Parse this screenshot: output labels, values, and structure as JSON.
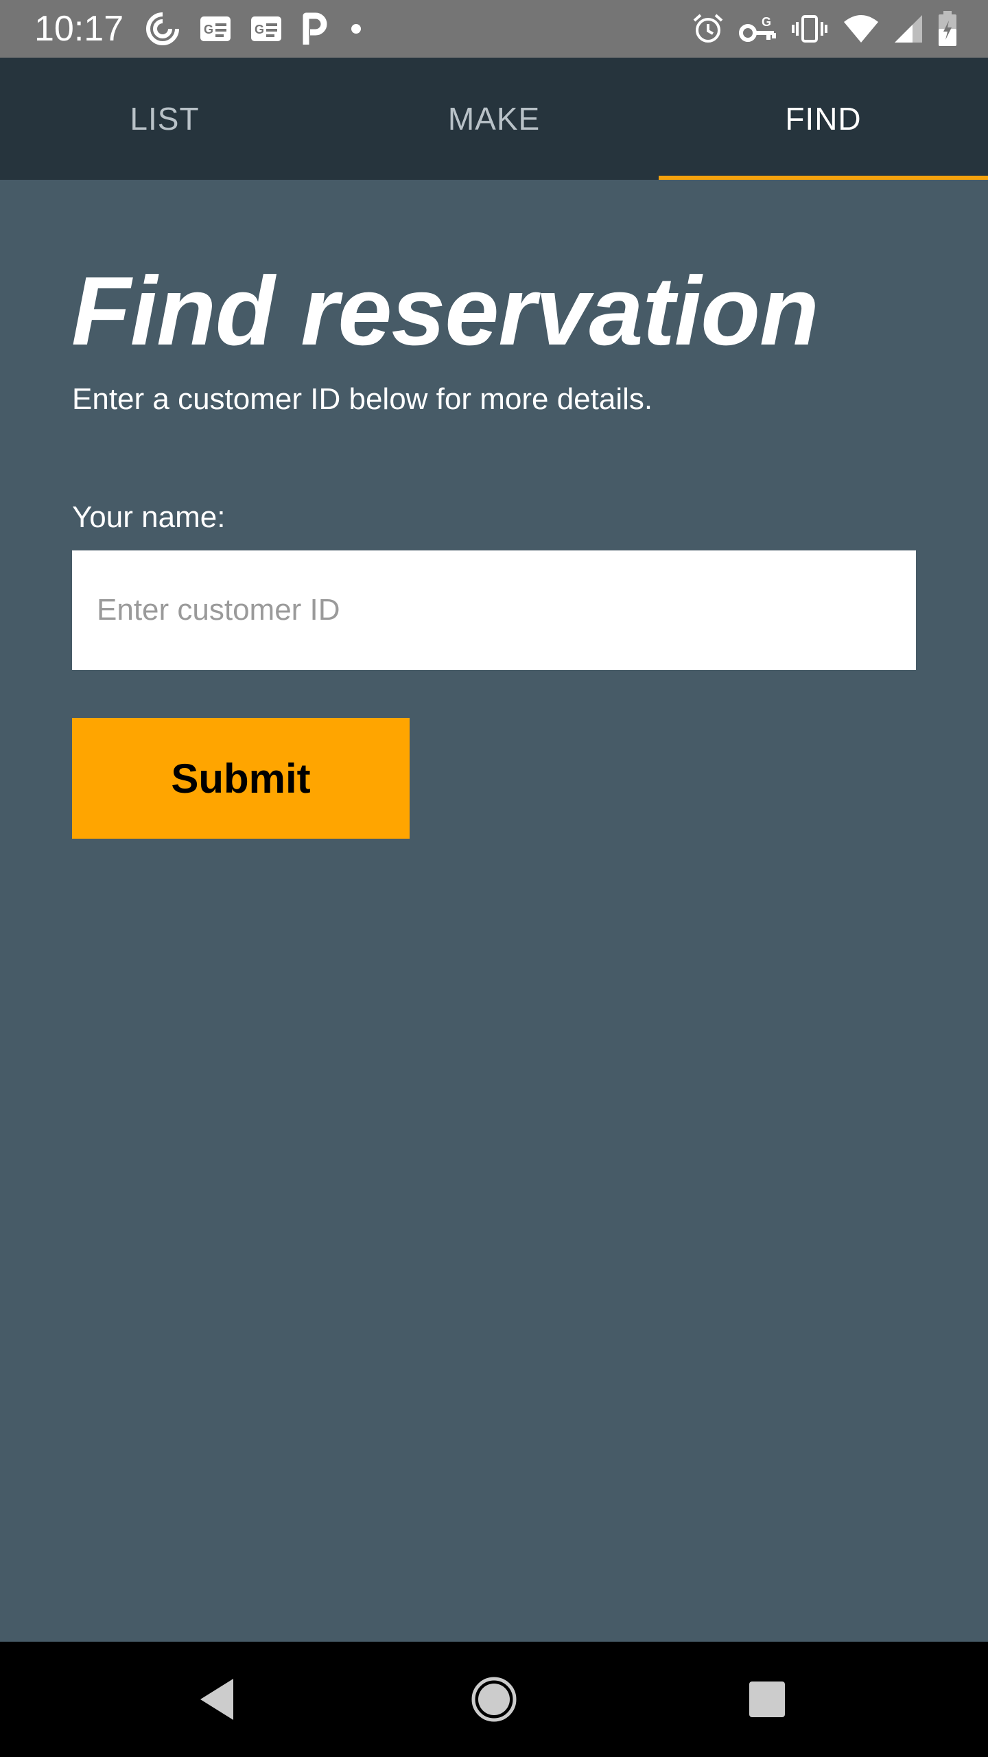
{
  "status_bar": {
    "time": "10:17",
    "left_icons": [
      "sync-icon",
      "news-icon",
      "news-icon",
      "parking-icon",
      "dot-icon"
    ],
    "right_icons": [
      "alarm-icon",
      "vpn-key-icon",
      "vibrate-icon",
      "wifi-icon",
      "signal-icon",
      "battery-icon"
    ]
  },
  "tabs": [
    {
      "label": "LIST",
      "active": false
    },
    {
      "label": "MAKE",
      "active": false
    },
    {
      "label": "FIND",
      "active": true
    }
  ],
  "main": {
    "title": "Find reservation",
    "subtitle": "Enter a customer ID below for more details.",
    "field_label": "Your name:",
    "input_placeholder": "Enter customer ID",
    "input_value": "",
    "submit_label": "Submit"
  },
  "nav_bar": {
    "buttons": [
      "back-icon",
      "home-icon",
      "recents-icon"
    ]
  },
  "colors": {
    "accent": "#ffa500",
    "tab_bar": "#26343d",
    "background": "#475b67",
    "status_bar": "#757575"
  }
}
